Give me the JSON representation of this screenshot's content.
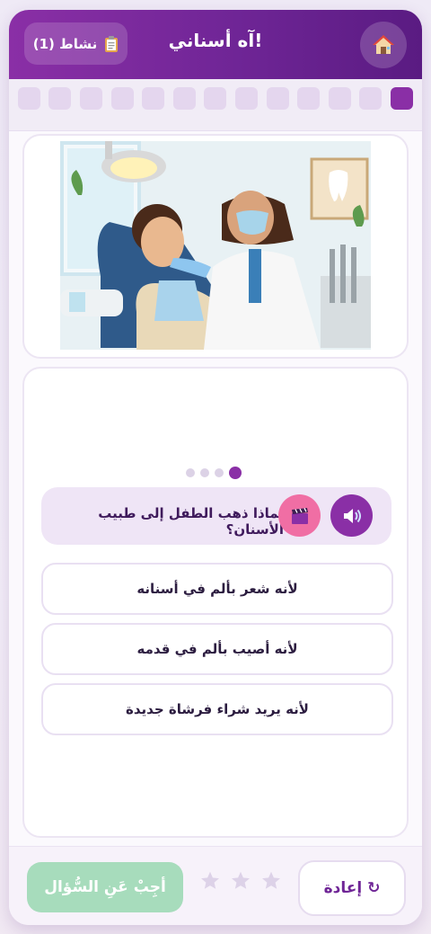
{
  "header": {
    "title": "آه أسناني!",
    "activity_label": "نشاط (1)",
    "activity_icon": "clipboard-icon",
    "home_icon": "house-icon"
  },
  "progress": {
    "total_steps": 13,
    "current_step": 1
  },
  "image": {
    "icon": "dentist-scene-illustration"
  },
  "question": {
    "pager": {
      "total": 4,
      "current": 4
    },
    "text": "لماذا ذهب الطفل إلى طبيب الأسنان؟",
    "audio_icon": "speaker-icon",
    "video_icon": "clapperboard-icon"
  },
  "answers": [
    {
      "label": "لأنه شعر بألم في أسنانه"
    },
    {
      "label": "لأنه أصيب بألم في قدمه"
    },
    {
      "label": "لأنه يريد شراء فرشاة جديدة"
    }
  ],
  "footer": {
    "retry_label": "إعادة",
    "retry_icon": "↻",
    "submit_label": "أجِبْ عَنِ السُّؤال",
    "stars_earned": 0,
    "stars_total": 3
  },
  "colors": {
    "brand": "#8a2fa6",
    "submit_disabled": "#a7dcbc",
    "video_button": "#f06ea4"
  }
}
